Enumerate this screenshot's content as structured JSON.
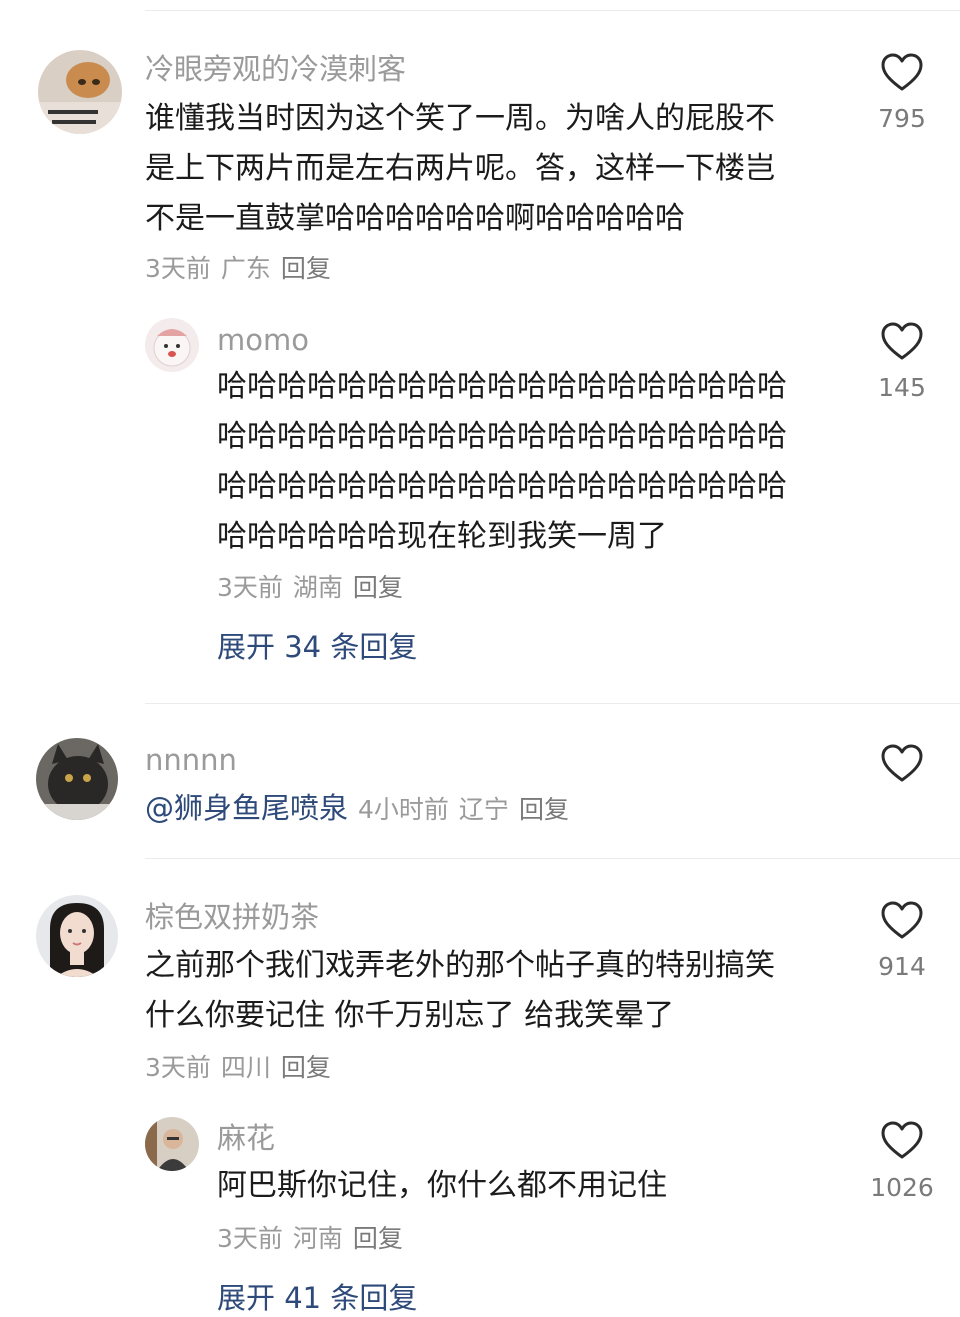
{
  "comments": [
    {
      "username": "冷眼旁观的冷漠刺客",
      "avatar_icon": "cat-meme-avatar",
      "text_lines": [
        "谁懂我当时因为这个笑了一周。为啥人的屁股不",
        "是上下两片而是左右两片呢。答，这样一下楼岂",
        "不是一直鼓掌哈哈哈哈哈哈啊哈哈哈哈哈"
      ],
      "time": "3天前",
      "location": "广东",
      "reply_label": "回复",
      "likes": "795",
      "sub_reply": {
        "username": "momo",
        "avatar_icon": "cartoon-bird-avatar",
        "text_lines": [
          "哈哈哈哈哈哈哈哈哈哈哈哈哈哈哈哈哈哈哈",
          "哈哈哈哈哈哈哈哈哈哈哈哈哈哈哈哈哈哈哈",
          "哈哈哈哈哈哈哈哈哈哈哈哈哈哈哈哈哈哈哈",
          "哈哈哈哈哈哈现在轮到我笑一周了"
        ],
        "time": "3天前",
        "location": "湖南",
        "reply_label": "回复",
        "likes": "145"
      },
      "expand_label": "展开 34 条回复"
    },
    {
      "username": "nnnnn",
      "avatar_icon": "black-cat-avatar",
      "mention": "@狮身鱼尾喷泉",
      "time": "4小时前",
      "location": "辽宁",
      "reply_label": "回复"
    },
    {
      "username": "棕色双拼奶茶",
      "avatar_icon": "girl-portrait-avatar",
      "text_lines": [
        "之前那个我们戏弄老外的那个帖子真的特别搞笑",
        "什么你要记住 你千万别忘了 给我笑晕了"
      ],
      "time": "3天前",
      "location": "四川",
      "reply_label": "回复",
      "likes": "914",
      "sub_reply": {
        "username": "麻花",
        "avatar_icon": "man-photo-avatar",
        "text_lines": [
          "阿巴斯你记住，你什么都不用记住"
        ],
        "time": "3天前",
        "location": "河南",
        "reply_label": "回复",
        "likes": "1026"
      },
      "expand_label": "展开 41 条回复"
    }
  ],
  "colors": {
    "username": "#9a9a9a",
    "link": "#2e4a7a",
    "text": "#1b1b1b",
    "divider": "#ececec"
  }
}
